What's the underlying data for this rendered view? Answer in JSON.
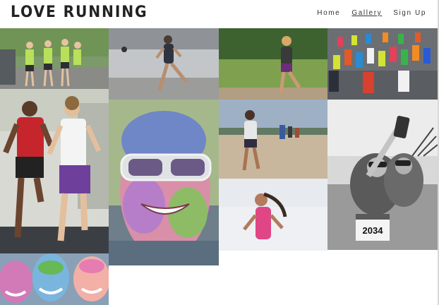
{
  "site": {
    "title": "LOVE RUNNING"
  },
  "nav": {
    "items": [
      {
        "label": "Home"
      },
      {
        "label": "Gallery"
      },
      {
        "label": "Sign Up"
      }
    ]
  },
  "gallery": {
    "bib_number": "2034"
  }
}
